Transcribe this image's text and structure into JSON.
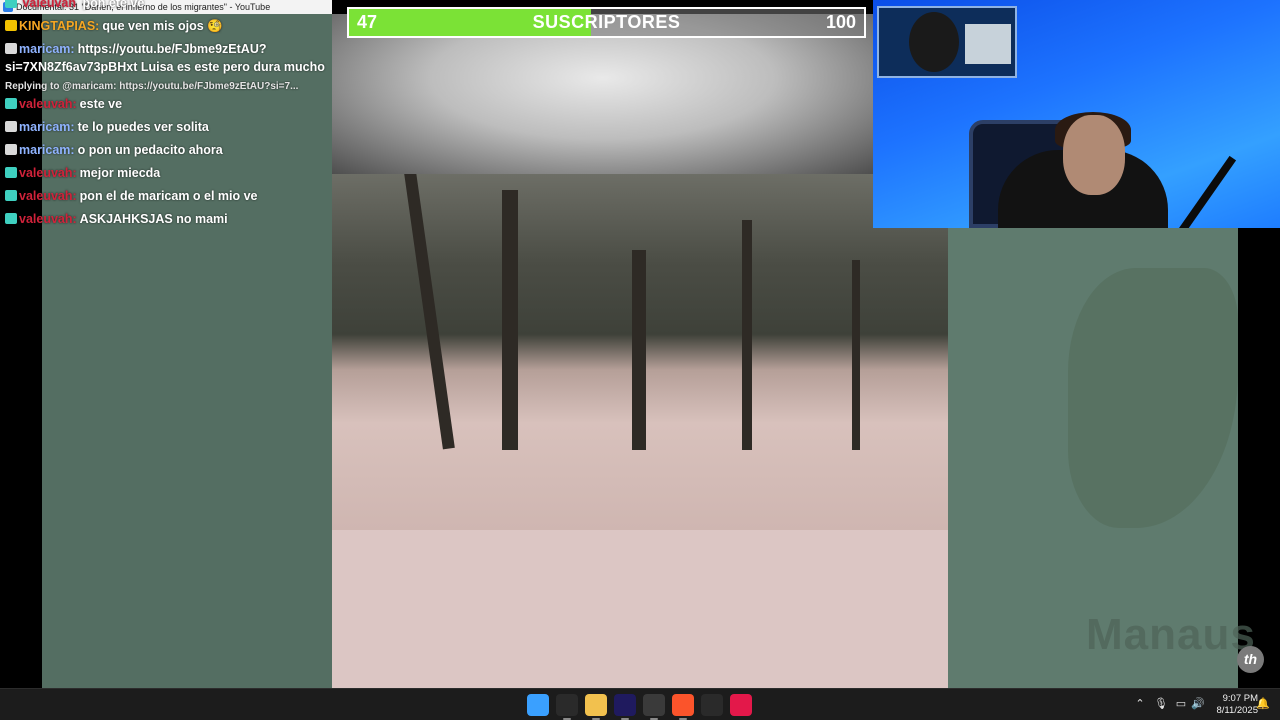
{
  "window": {
    "title": "Documental: 31 \"Darién, el infierno de los migrantes\" - YouTube"
  },
  "progress_bar": {
    "current": "47",
    "label": "SUSCRIPTORES",
    "goal": "100",
    "fraction": 0.47,
    "fill_color": "#7be236"
  },
  "chat": {
    "top_partial": {
      "name": "valeuvah",
      "text": "pon ete ve"
    },
    "messages": [
      {
        "badge": "crown-icon",
        "badge_color": "#f2c200",
        "name": "KINGTAPIAS:",
        "name_color": "#f5a623",
        "text": "que ven mis ojos 🧐"
      },
      {
        "badge": "shield-icon",
        "badge_color": "#d9d9d9",
        "name": "maricam:",
        "name_color": "#8fb3ff",
        "text": "https://youtu.be/FJbme9zEtAU?si=7XN8Zf6av73pBHxt Luisa es este pero dura mucho"
      },
      {
        "reply": "Replying to @maricam: https://youtu.be/FJbme9zEtAU?si=7..."
      },
      {
        "badge": "gift-icon",
        "badge_color": "#3fd0c0",
        "name": "valeuvah:",
        "name_color": "#d0223a",
        "text": "este ve"
      },
      {
        "badge": "shield-icon",
        "badge_color": "#d9d9d9",
        "name": "maricam:",
        "name_color": "#8fb3ff",
        "text": "te lo puedes ver solita"
      },
      {
        "badge": "shield-icon",
        "badge_color": "#d9d9d9",
        "name": "maricam:",
        "name_color": "#8fb3ff",
        "text": "o pon un pedacito ahora"
      },
      {
        "badge": "gift-icon",
        "badge_color": "#3fd0c0",
        "name": "valeuvah:",
        "name_color": "#d0223a",
        "text": "mejor miecda"
      },
      {
        "badge": "gift-icon",
        "badge_color": "#3fd0c0",
        "name": "valeuvah:",
        "name_color": "#d0223a",
        "text": "pon el de maricam o el mio ve"
      },
      {
        "badge": "gift-icon",
        "badge_color": "#3fd0c0",
        "name": "valeuvah:",
        "name_color": "#d0223a",
        "text": "ASKJAHKSJAS no mami"
      }
    ]
  },
  "map": {
    "place_label": "Manaus"
  },
  "watermark": {
    "text": "th"
  },
  "taskbar": {
    "apps": [
      {
        "name": "start-button",
        "icon": "windows-icon",
        "color": "#3aa0ff"
      },
      {
        "name": "epic-games-button",
        "icon": "epic-games-icon",
        "color": "#2a2a2a"
      },
      {
        "name": "file-explorer-button",
        "icon": "folder-icon",
        "color": "#f2c14e"
      },
      {
        "name": "premiere-button",
        "icon": "premiere-icon",
        "color": "#1f1a5e"
      },
      {
        "name": "obs-button",
        "icon": "obs-icon",
        "color": "#3a3a3a"
      },
      {
        "name": "brave-button",
        "icon": "brave-icon",
        "color": "#fb542b"
      },
      {
        "name": "capcut-button",
        "icon": "capcut-icon",
        "color": "#2a2a2a"
      },
      {
        "name": "tiktok-button",
        "icon": "tiktok-icon",
        "color": "#e3184a"
      }
    ],
    "time": "9:07 PM",
    "date": "8/11/2025"
  }
}
